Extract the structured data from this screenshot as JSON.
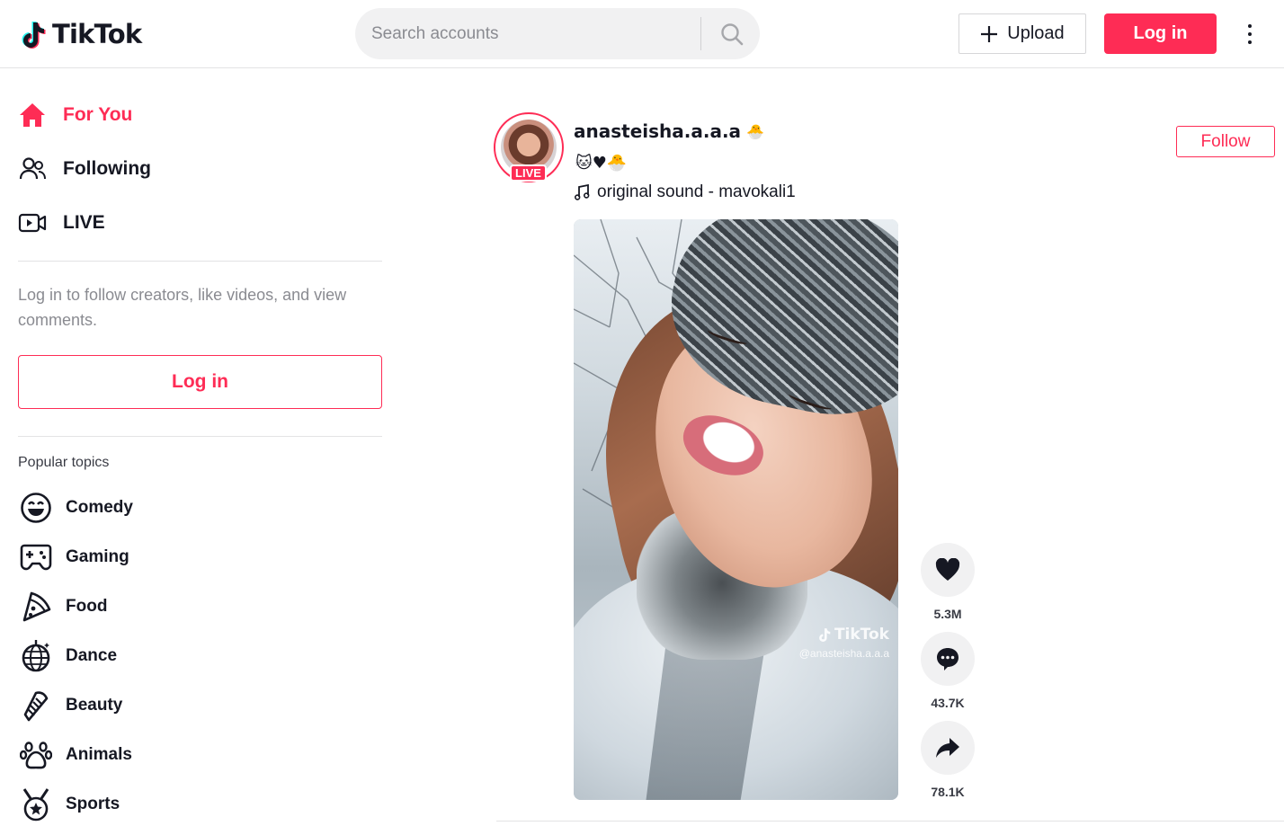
{
  "header": {
    "logo_text": "TikTok",
    "search_placeholder": "Search accounts",
    "upload_label": "Upload",
    "login_label": "Log in"
  },
  "sidebar": {
    "nav": [
      {
        "label": "For You",
        "icon": "home-icon",
        "active": true
      },
      {
        "label": "Following",
        "icon": "people-icon",
        "active": false
      },
      {
        "label": "LIVE",
        "icon": "live-camera-icon",
        "active": false
      }
    ],
    "login_hint": "Log in to follow creators, like videos, and view comments.",
    "login_label": "Log in",
    "topics_title": "Popular topics",
    "topics": [
      {
        "label": "Comedy",
        "icon": "smile-icon"
      },
      {
        "label": "Gaming",
        "icon": "gamepad-icon"
      },
      {
        "label": "Food",
        "icon": "pizza-icon"
      },
      {
        "label": "Dance",
        "icon": "disco-ball-icon"
      },
      {
        "label": "Beauty",
        "icon": "comb-icon"
      },
      {
        "label": "Animals",
        "icon": "paw-icon"
      },
      {
        "label": "Sports",
        "icon": "medal-icon"
      }
    ]
  },
  "post": {
    "username": "anasteisha.a.a.a",
    "username_emoji": "🐣",
    "caption": "🐱♥🐣",
    "live_badge": "LIVE",
    "music": "original sound - mavokali1",
    "follow_label": "Follow",
    "watermark_logo": "TikTok",
    "watermark_handle": "@anasteisha.a.a.a",
    "likes": "5.3M",
    "comments": "43.7K",
    "shares": "78.1K"
  },
  "colors": {
    "brand": "#fe2c55",
    "text": "#161823",
    "muted": "#8a8b91"
  }
}
